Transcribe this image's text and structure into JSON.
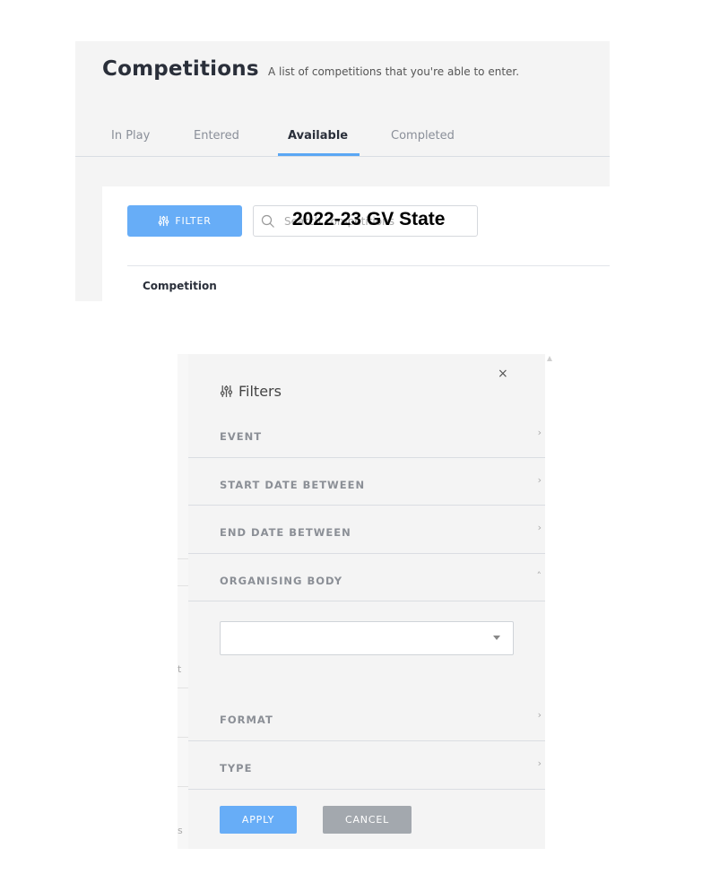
{
  "header": {
    "title": "Competitions",
    "subtitle": "A list of competitions that you're able to enter."
  },
  "tabs": [
    {
      "label": "In Play",
      "active": false
    },
    {
      "label": "Entered",
      "active": false
    },
    {
      "label": "Available",
      "active": true
    },
    {
      "label": "Completed",
      "active": false
    }
  ],
  "toolbar": {
    "filter_label": "FILTER",
    "search_placeholder": "Search competitions",
    "search_overlay_text": "2022-23 GV State"
  },
  "table": {
    "column_header": "Competition"
  },
  "filters_drawer": {
    "title": "Filters",
    "close_glyph": "×",
    "sections": [
      {
        "label": "EVENT",
        "expanded": false
      },
      {
        "label": "START DATE BETWEEN",
        "expanded": false
      },
      {
        "label": "END DATE BETWEEN",
        "expanded": false
      },
      {
        "label": "ORGANISING BODY",
        "expanded": true
      },
      {
        "label": "FORMAT",
        "expanded": false
      },
      {
        "label": "TYPE",
        "expanded": false
      }
    ],
    "organising_body_value": "",
    "apply_label": "APPLY",
    "cancel_label": "CANCEL",
    "background_hint_chars": [
      "t",
      "s"
    ]
  },
  "colors": {
    "accent": "#67adf7",
    "cancel": "#a3a8ae",
    "panel_bg": "#f4f4f4"
  },
  "icons": {
    "filter": "sliders-icon",
    "search": "search-icon",
    "close": "close-icon",
    "collapsed": "chevron-right-icon",
    "expanded": "chevron-up-icon",
    "select": "caret-down-icon"
  }
}
